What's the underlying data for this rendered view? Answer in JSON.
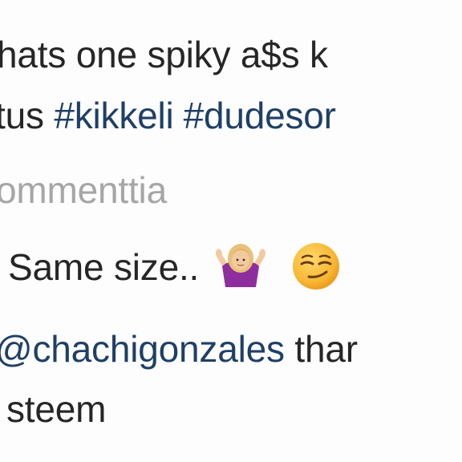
{
  "caption": {
    "line1": "hats one spiky a$s k",
    "line2_prefix": "tus ",
    "line2_tag1": "#kikkeli",
    "line2_tag2": "#dudesor"
  },
  "comment_link": {
    "label": "ommenttia"
  },
  "reply1": {
    "text": "Same size..",
    "emojis": [
      "woman-shrugging-icon",
      "smirking-face-icon"
    ]
  },
  "reply2": {
    "mention": "@chachigonzales",
    "text_after": " thar",
    "line2": "steem"
  },
  "colors": {
    "text": "#262626",
    "hashtag": "#1f3f66",
    "muted": "#a6a6a6",
    "background": "#fdfdfd",
    "emoji_yellow": "#f7b733",
    "shrug_shirt": "#8e2e9e"
  }
}
